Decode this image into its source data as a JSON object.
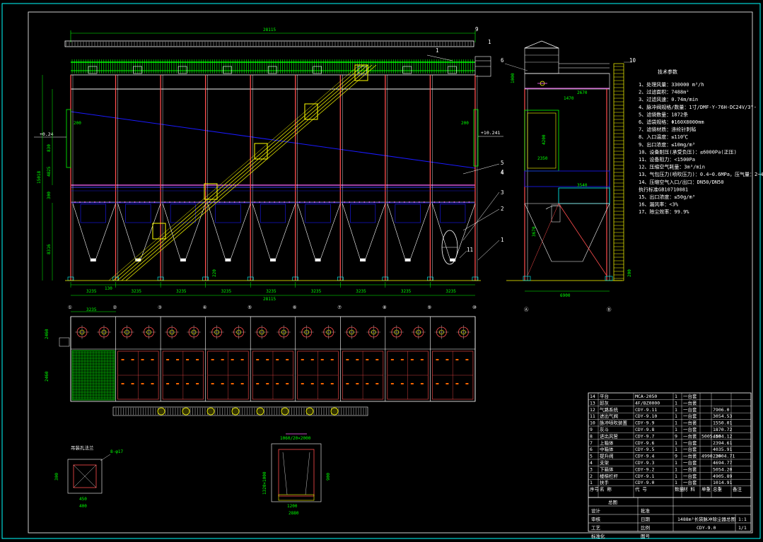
{
  "drawing": {
    "total_length": "28115",
    "bay_width": "3235",
    "bay_dims": [
      "3235",
      "3235",
      "3235",
      "3235",
      "3235",
      "3235",
      "3235",
      "3235",
      "3235"
    ],
    "bottom_total": "28115",
    "start_offset": "130",
    "height_total": "15018",
    "upper_height": "4825",
    "lower_height": "8316",
    "dim_830": "830",
    "dim_200": "200",
    "dim_300": "300",
    "dim_220": "220",
    "left_level": "+0.24",
    "right_level": "+10.241",
    "plan_width": "7460",
    "plan_height": "2460",
    "callouts": [
      "1",
      "2",
      "3",
      "4",
      "5",
      "6",
      "9",
      "10",
      "11"
    ],
    "side_width": "6900",
    "side_dims": [
      "1000",
      "4200",
      "3670",
      "3540",
      "2350",
      "1470",
      "2670"
    ],
    "grid_labels": [
      "①",
      "②",
      "③",
      "④",
      "⑤",
      "⑥",
      "⑦",
      "⑧",
      "⑨",
      "⑩"
    ],
    "side_grid": [
      "Ⓐ",
      "Ⓑ"
    ],
    "detail_a_title": "吊装孔法兰",
    "detail_a_dims": [
      "400",
      "450",
      "300",
      "8-φ17"
    ],
    "detail_b_dims": [
      "1060/20×2000",
      "1320×1000",
      "2880",
      "1200",
      "900"
    ]
  },
  "notes": {
    "title": "技术参数",
    "lines": [
      "1、处理风量：330000 m³/h",
      "2、过滤面积：7488m²",
      "3、过滤风速：0.74m/min",
      "4、脉冲阀规格/数量：1寸/DMF-Y-76H-DC24V/3\"-",
      "5、滤袋数量：1872条",
      "6、滤袋规格：Φ160X8000mm",
      "7、滤袋材质：涤纶针刺毡",
      "8、入口温度：≤110℃",
      "9、出口浓度：≤10mg/m³",
      "10、设备耐压(承受负压)：≤6000Pa(正压)",
      "11、设备阻力：<1500Pa",
      "12、压缩空气耗量：3m³/min",
      "13、气包压力(喷吹压力)：0.4~0.6MPa，压气量：2~4m/min",
      "14、压缩空气入口/出口：DN50/DN50",
      "   执行标准GB10710081",
      "15、出口浓度：≤50g/m³",
      "16、漏风率：<3%",
      "17、除尘效率：99.9%"
    ]
  },
  "bom": {
    "rows": [
      {
        "no": "14",
        "name": "平台",
        "code": "MCA-2050",
        "qty": "1",
        "unit": "一台套",
        "spec": "",
        "weight": ""
      },
      {
        "no": "13",
        "name": "卸灰",
        "code": "4F/BZ0000",
        "qty": "1",
        "unit": "一台套",
        "spec": "",
        "weight": ""
      },
      {
        "no": "12",
        "name": "气路系统",
        "code": "CDY-9.11",
        "qty": "1",
        "unit": "一台套",
        "spec": "",
        "weight": "7906.0"
      },
      {
        "no": "11",
        "name": "进出气阀",
        "code": "CDY-9.10",
        "qty": "1",
        "unit": "一台套",
        "spec": "",
        "weight": "3054.53"
      },
      {
        "no": "10",
        "name": "脉冲喷吹装置",
        "code": "CDY-9.9",
        "qty": "1",
        "unit": "一台套",
        "spec": "",
        "weight": "1550.01"
      },
      {
        "no": "9",
        "name": "灰斗",
        "code": "CDY-9.8",
        "qty": "1",
        "unit": "一台套",
        "spec": "",
        "weight": "1870.72"
      },
      {
        "no": "8",
        "name": "进出风管",
        "code": "CDY-9.7",
        "qty": "9",
        "unit": "一台套",
        "spec": "5005.50",
        "weight": "4404.12"
      },
      {
        "no": "7",
        "name": "上箱体",
        "code": "CDY-9.6",
        "qty": "1",
        "unit": "一台套",
        "spec": "",
        "weight": "2394.61"
      },
      {
        "no": "6",
        "name": "中箱体",
        "code": "CDY-9.5",
        "qty": "1",
        "unit": "一台套",
        "spec": "",
        "weight": "4035.91"
      },
      {
        "no": "5",
        "name": "提升阀",
        "code": "CDY-9.4",
        "qty": "9",
        "unit": "一台套",
        "spec": "4990.20",
        "weight": "23904.71"
      },
      {
        "no": "4",
        "name": "支架",
        "code": "CDY-9.3",
        "qty": "1",
        "unit": "一台套",
        "spec": "",
        "weight": "4694.77"
      },
      {
        "no": "3",
        "name": "下箱体",
        "code": "CDY-9.2",
        "qty": "1",
        "unit": "一台套",
        "spec": "",
        "weight": "5054.20"
      },
      {
        "no": "2",
        "name": "楼梯栏杆",
        "code": "CDY-9.1",
        "qty": "1",
        "unit": "一台套",
        "spec": "",
        "weight": "4905.89"
      },
      {
        "no": "1",
        "name": "扶手",
        "code": "CDY-9.0",
        "qty": "1",
        "unit": "一台套",
        "spec": "",
        "weight": "1014.91"
      }
    ],
    "header": [
      "序号",
      "名 称",
      "代 号",
      "数量",
      "材 料",
      "单重",
      "总重",
      "备注"
    ]
  },
  "title_block": {
    "company": "总图",
    "drawing_name": "1488m²长袋脉冲除尘器总图",
    "drawing_no": "CDY-9.0",
    "scale": "1:1",
    "sheet": "1/1",
    "labels": [
      "设计",
      "审核",
      "工艺",
      "标准化",
      "批准",
      "日期",
      "比例",
      "图号"
    ]
  },
  "colors": {
    "frame": "#00ffff",
    "dim": "#00ff00",
    "structure": "#ff4d4d",
    "accent": "#ffff00",
    "blue": "#1a1aff"
  }
}
